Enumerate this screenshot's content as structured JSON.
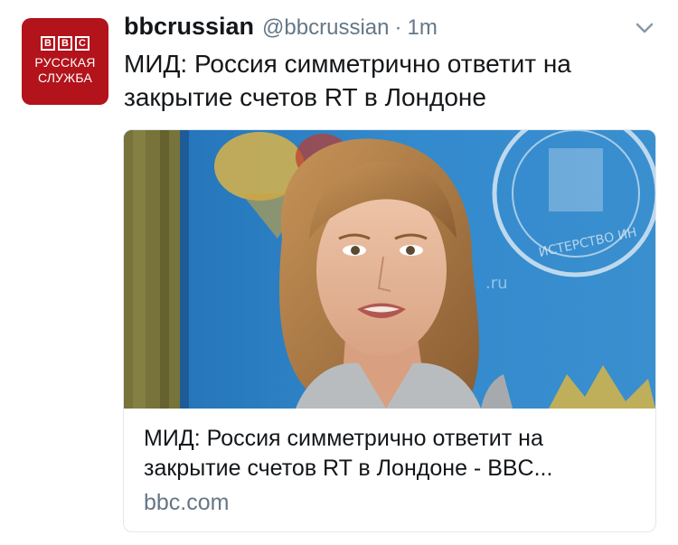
{
  "avatar": {
    "bbc_letters": [
      "B",
      "B",
      "C"
    ],
    "line1": "РУССКАЯ",
    "line2": "СЛУЖБА",
    "color": "#b3131b"
  },
  "header": {
    "display_name": "bbcrussian",
    "handle": "@bbcrussian",
    "separator": "·",
    "time": "1m",
    "menu_icon": "chevron-down-icon"
  },
  "tweet": {
    "text": "МИД: Россия симметрично ответит на закрытие счетов RT в Лондоне"
  },
  "card": {
    "title": "МИД: Россия симметрично ответит на закрытие счетов RT в Лондоне - BBC...",
    "domain": "bbc.com",
    "image_description": "photo-of-spokeswoman"
  },
  "colors": {
    "text_primary": "#14171a",
    "text_secondary": "#657786",
    "card_border": "#e1e8ed",
    "backdrop_blue": "#2d7fc2"
  }
}
